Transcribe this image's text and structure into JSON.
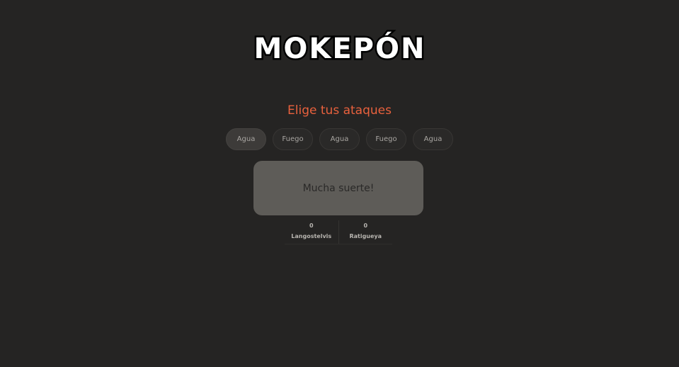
{
  "app": {
    "logo_text": "MOKEPÓN"
  },
  "attack_section": {
    "title": "Elige tus ataques",
    "attacks": [
      {
        "label": "Agua",
        "selected": true
      },
      {
        "label": "Fuego",
        "selected": false
      },
      {
        "label": "Agua",
        "selected": false
      },
      {
        "label": "Fuego",
        "selected": false
      },
      {
        "label": "Agua",
        "selected": false
      }
    ]
  },
  "message": {
    "text": "Mucha suerte!"
  },
  "scoreboard": {
    "player": {
      "score": "0",
      "name": "Langostelvis"
    },
    "enemy": {
      "score": "0",
      "name": "Ratigueya"
    }
  },
  "colors": {
    "background": "#252423",
    "accent": "#e9613d",
    "message_box": "#5e5c58"
  }
}
